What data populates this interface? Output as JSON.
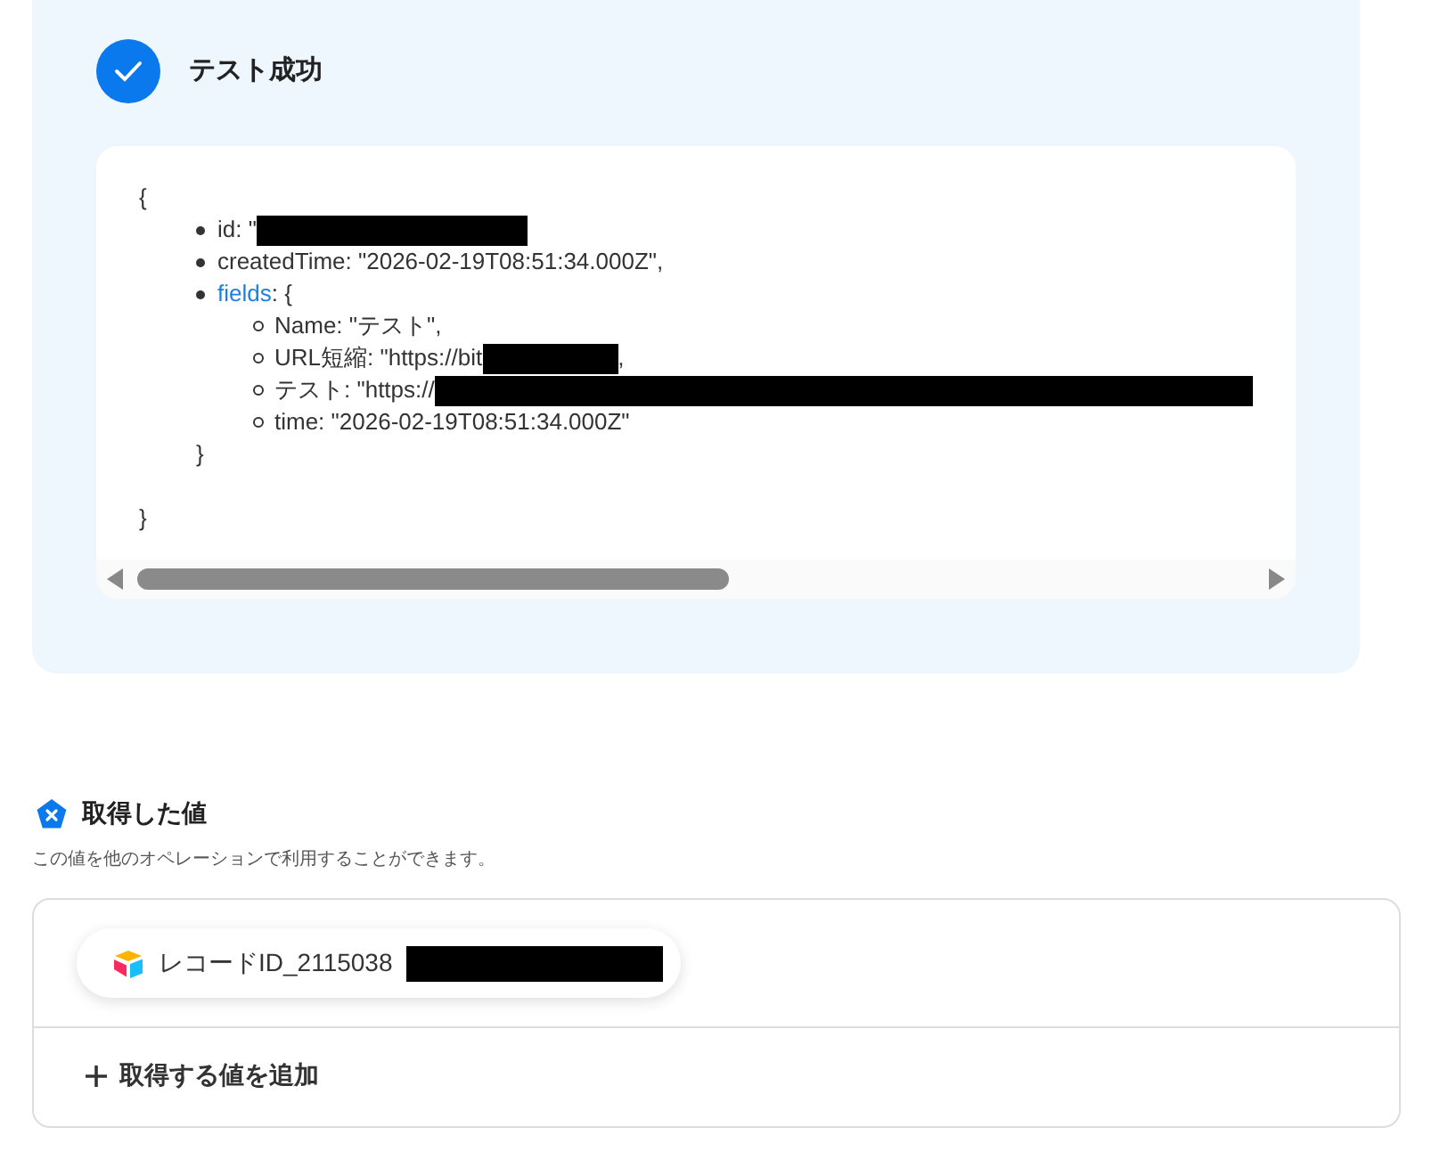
{
  "test_result": {
    "title": "テスト成功",
    "succeeded": true,
    "preview": {
      "open": "{",
      "close": "}",
      "items": [
        {
          "text": "id: \"",
          "kind": "redacted-medium"
        },
        {
          "text": "createdTime: \"2026-02-19T08:51:34.000Z\",",
          "kind": "plain"
        },
        {
          "link": "fields",
          "text": ": {",
          "kind": "plain",
          "children": [
            {
              "text": "Name: \"テスト\",",
              "kind": "plain"
            },
            {
              "text": "URL短縮: \"https://bit",
              "kind": "redacted-short",
              "tail": ","
            },
            {
              "text": "テスト: \"https://",
              "kind": "redacted-long"
            },
            {
              "text": "time: \"2026-02-19T08:51:34.000Z\"",
              "kind": "plain"
            }
          ],
          "child_close": "}"
        }
      ]
    }
  },
  "captured_values": {
    "title": "取得した値",
    "description": "この値を他のオペレーションで利用することができます。",
    "values": [
      {
        "label": "レコードID_2115038",
        "kind": "redacted-medium"
      }
    ],
    "add_button": "取得する値を追加"
  }
}
